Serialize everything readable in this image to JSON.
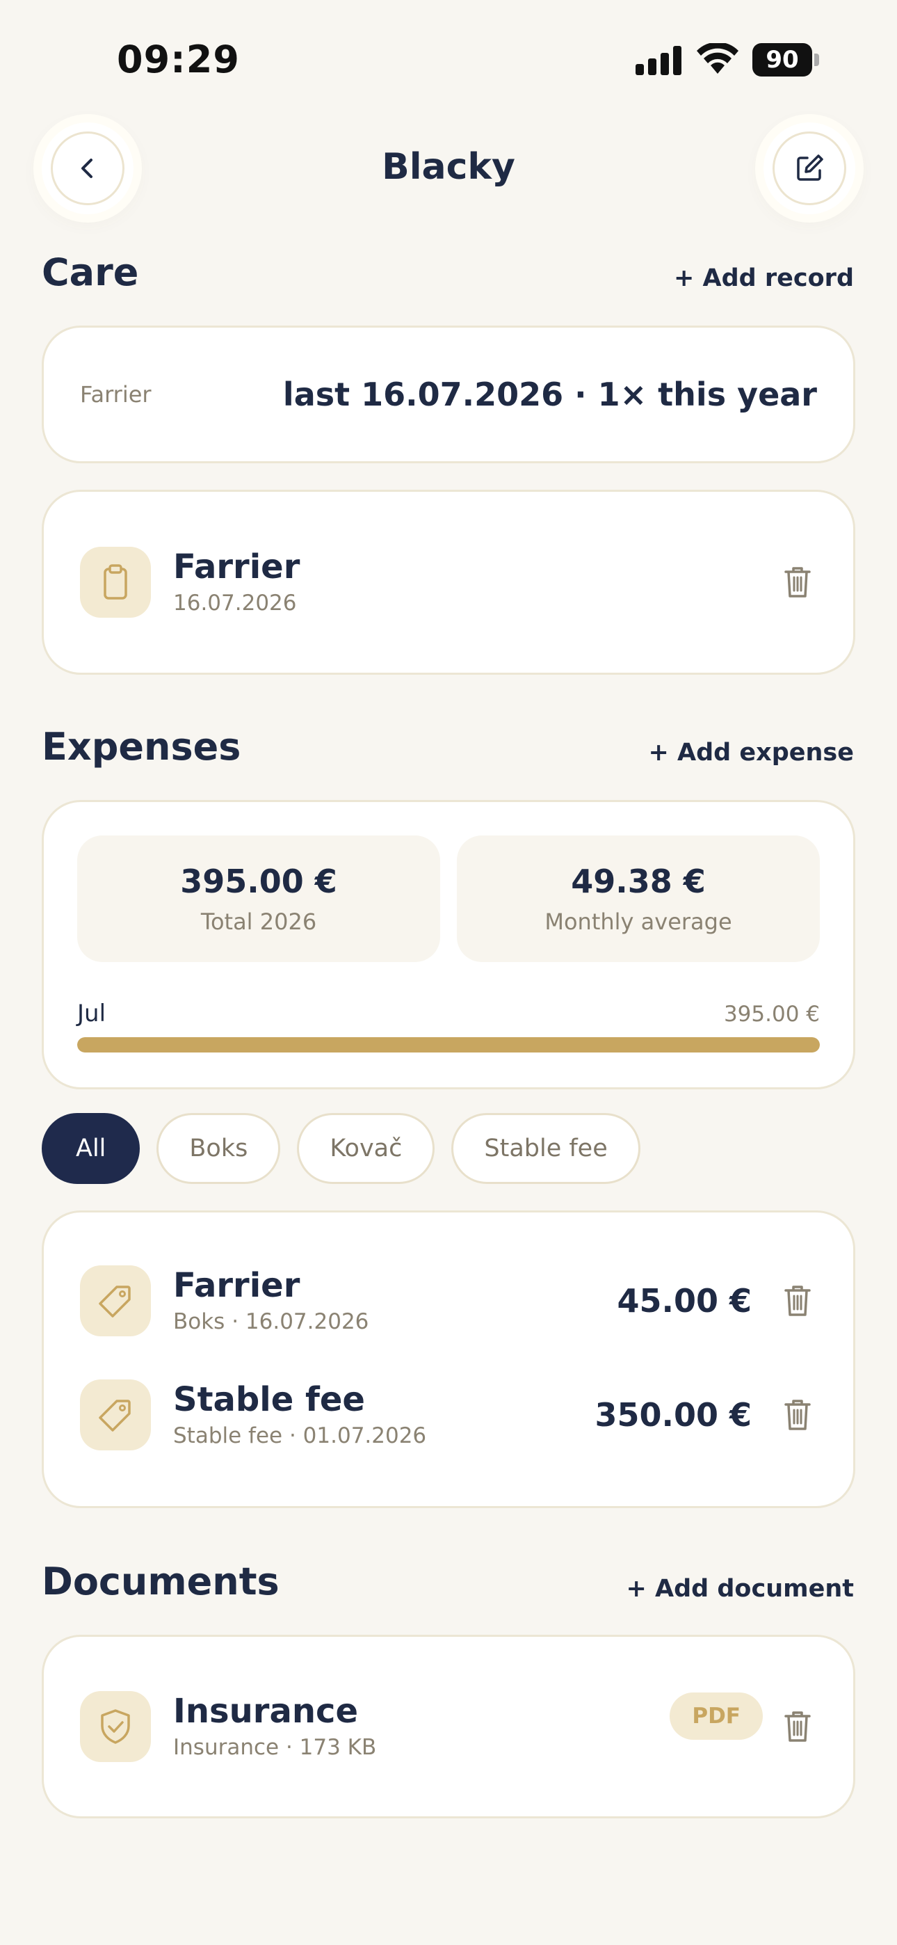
{
  "status_bar": {
    "time": "09:29",
    "battery": "90"
  },
  "header": {
    "title": "Blacky",
    "back_icon": "chevron-left-icon",
    "edit_icon": "edit-square-icon"
  },
  "care": {
    "title": "Care",
    "add_label": "+ Add record",
    "summary": {
      "label": "Farrier",
      "value": "last 16.07.2026 · 1× this year"
    },
    "records": [
      {
        "icon": "clipboard-icon",
        "title": "Farrier",
        "date": "16.07.2026"
      }
    ]
  },
  "expenses": {
    "title": "Expenses",
    "add_label": "+ Add expense",
    "total": {
      "value": "395.00 €",
      "label": "Total 2026"
    },
    "average": {
      "value": "49.38 €",
      "label": "Monthly average"
    },
    "months": [
      {
        "month": "Jul",
        "amount": "395.00 €",
        "fraction": 1.0
      }
    ],
    "filters": [
      {
        "label": "All",
        "active": true
      },
      {
        "label": "Boks",
        "active": false
      },
      {
        "label": "Kovač",
        "active": false
      },
      {
        "label": "Stable fee",
        "active": false
      }
    ],
    "items": [
      {
        "icon": "tag-icon",
        "title": "Farrier",
        "sub": "Boks · 16.07.2026",
        "amount": "45.00 €"
      },
      {
        "icon": "tag-icon",
        "title": "Stable fee",
        "sub": "Stable fee · 01.07.2026",
        "amount": "350.00 €"
      }
    ]
  },
  "documents": {
    "title": "Documents",
    "add_label": "+ Add document",
    "items": [
      {
        "icon": "shield-check-icon",
        "title": "Insurance",
        "sub": "Insurance · 173 KB",
        "type": "PDF"
      }
    ]
  },
  "colors": {
    "background": "#f8f6f1",
    "navy": "#1f2a44",
    "gold": "#c8a660",
    "tile": "#f3ead2"
  }
}
